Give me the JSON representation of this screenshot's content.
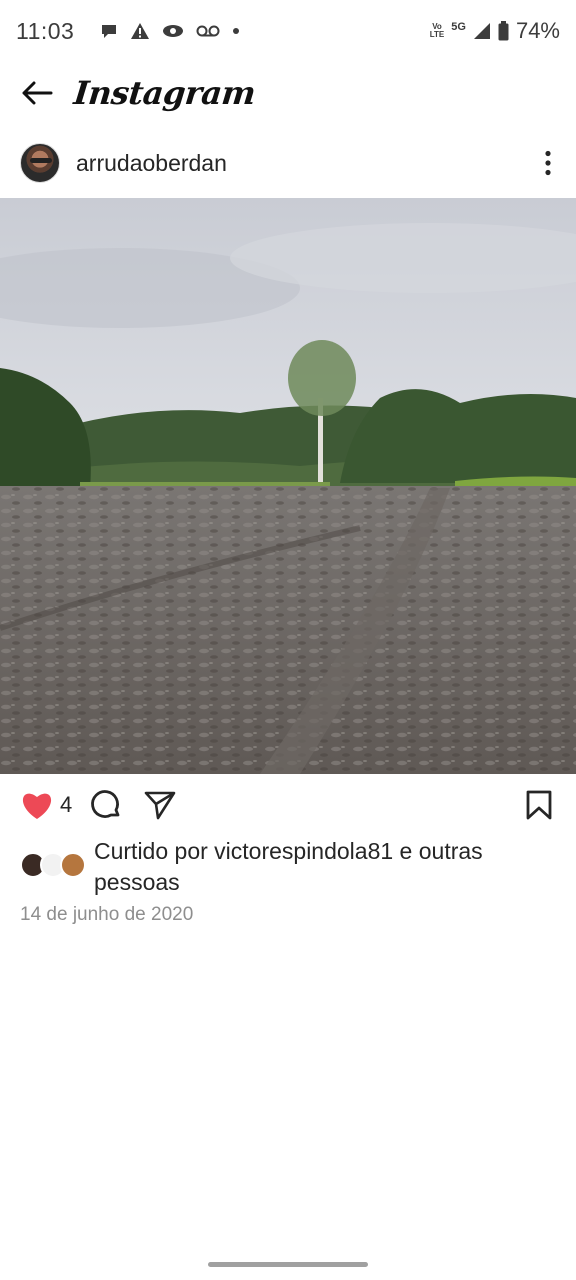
{
  "status_bar": {
    "time": "11:03",
    "network_top": "Vo",
    "network_bottom": "LTE",
    "signal_label": "5G",
    "battery": "74%",
    "left_icons": [
      "chat-bubble-icon",
      "warning-icon",
      "eye-icon",
      "voicemail-icon",
      "dot-icon"
    ],
    "right_icons": [
      "volte-icon",
      "signal-5g-icon",
      "battery-icon"
    ]
  },
  "header": {
    "brand": "Instagram",
    "back_icon": "back-arrow-icon"
  },
  "post": {
    "username": "arrudaoberdan",
    "menu_icon": "more-vertical-icon",
    "like_count": "4",
    "liked_by_text": "Curtido por victorespindola81 e outras pessoas",
    "date": "14 de junho de 2020",
    "actions": [
      "heart-filled-icon",
      "comment-icon",
      "share-icon",
      "bookmark-icon"
    ],
    "photo_alt": ""
  },
  "colors": {
    "heart": "#ed4956",
    "text": "#262626",
    "secondary_text": "#8e8e8e",
    "status_text": "#3c3c3c"
  }
}
